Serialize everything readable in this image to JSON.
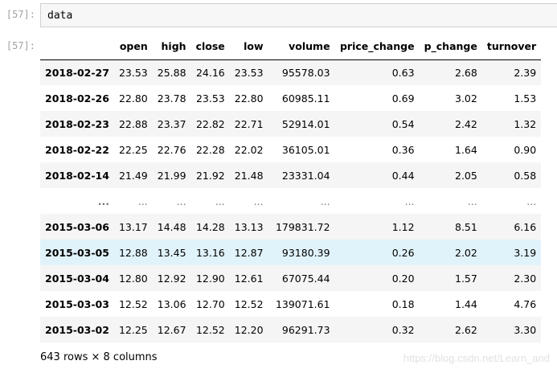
{
  "cell": {
    "in_prompt": "[57]:",
    "out_prompt": "[57]:",
    "code": "data"
  },
  "table": {
    "index_header": "",
    "columns": [
      "open",
      "high",
      "close",
      "low",
      "volume",
      "price_change",
      "p_change",
      "turnover"
    ],
    "rows": [
      {
        "index": "2018-02-27",
        "values": [
          "23.53",
          "25.88",
          "24.16",
          "23.53",
          "95578.03",
          "0.63",
          "2.68",
          "2.39"
        ]
      },
      {
        "index": "2018-02-26",
        "values": [
          "22.80",
          "23.78",
          "23.53",
          "22.80",
          "60985.11",
          "0.69",
          "3.02",
          "1.53"
        ]
      },
      {
        "index": "2018-02-23",
        "values": [
          "22.88",
          "23.37",
          "22.82",
          "22.71",
          "52914.01",
          "0.54",
          "2.42",
          "1.32"
        ]
      },
      {
        "index": "2018-02-22",
        "values": [
          "22.25",
          "22.76",
          "22.28",
          "22.02",
          "36105.01",
          "0.36",
          "1.64",
          "0.90"
        ]
      },
      {
        "index": "2018-02-14",
        "values": [
          "21.49",
          "21.99",
          "21.92",
          "21.48",
          "23331.04",
          "0.44",
          "2.05",
          "0.58"
        ]
      },
      {
        "index": "...",
        "values": [
          "...",
          "...",
          "...",
          "...",
          "...",
          "...",
          "...",
          "..."
        ]
      },
      {
        "index": "2015-03-06",
        "values": [
          "13.17",
          "14.48",
          "14.28",
          "13.13",
          "179831.72",
          "1.12",
          "8.51",
          "6.16"
        ]
      },
      {
        "index": "2015-03-05",
        "values": [
          "12.88",
          "13.45",
          "13.16",
          "12.87",
          "93180.39",
          "0.26",
          "2.02",
          "3.19"
        ]
      },
      {
        "index": "2015-03-04",
        "values": [
          "12.80",
          "12.92",
          "12.90",
          "12.61",
          "67075.44",
          "0.20",
          "1.57",
          "2.30"
        ]
      },
      {
        "index": "2015-03-03",
        "values": [
          "12.52",
          "13.06",
          "12.70",
          "12.52",
          "139071.61",
          "0.18",
          "1.44",
          "4.76"
        ]
      },
      {
        "index": "2015-03-02",
        "values": [
          "12.25",
          "12.67",
          "12.52",
          "12.20",
          "96291.73",
          "0.32",
          "2.62",
          "3.30"
        ]
      }
    ],
    "hover_row_color": "#e1f3fa",
    "stripe_color": "#f5f5f5"
  },
  "summary": "643 rows × 8 columns",
  "watermark": "https://blog.csdn.net/Learn_and"
}
